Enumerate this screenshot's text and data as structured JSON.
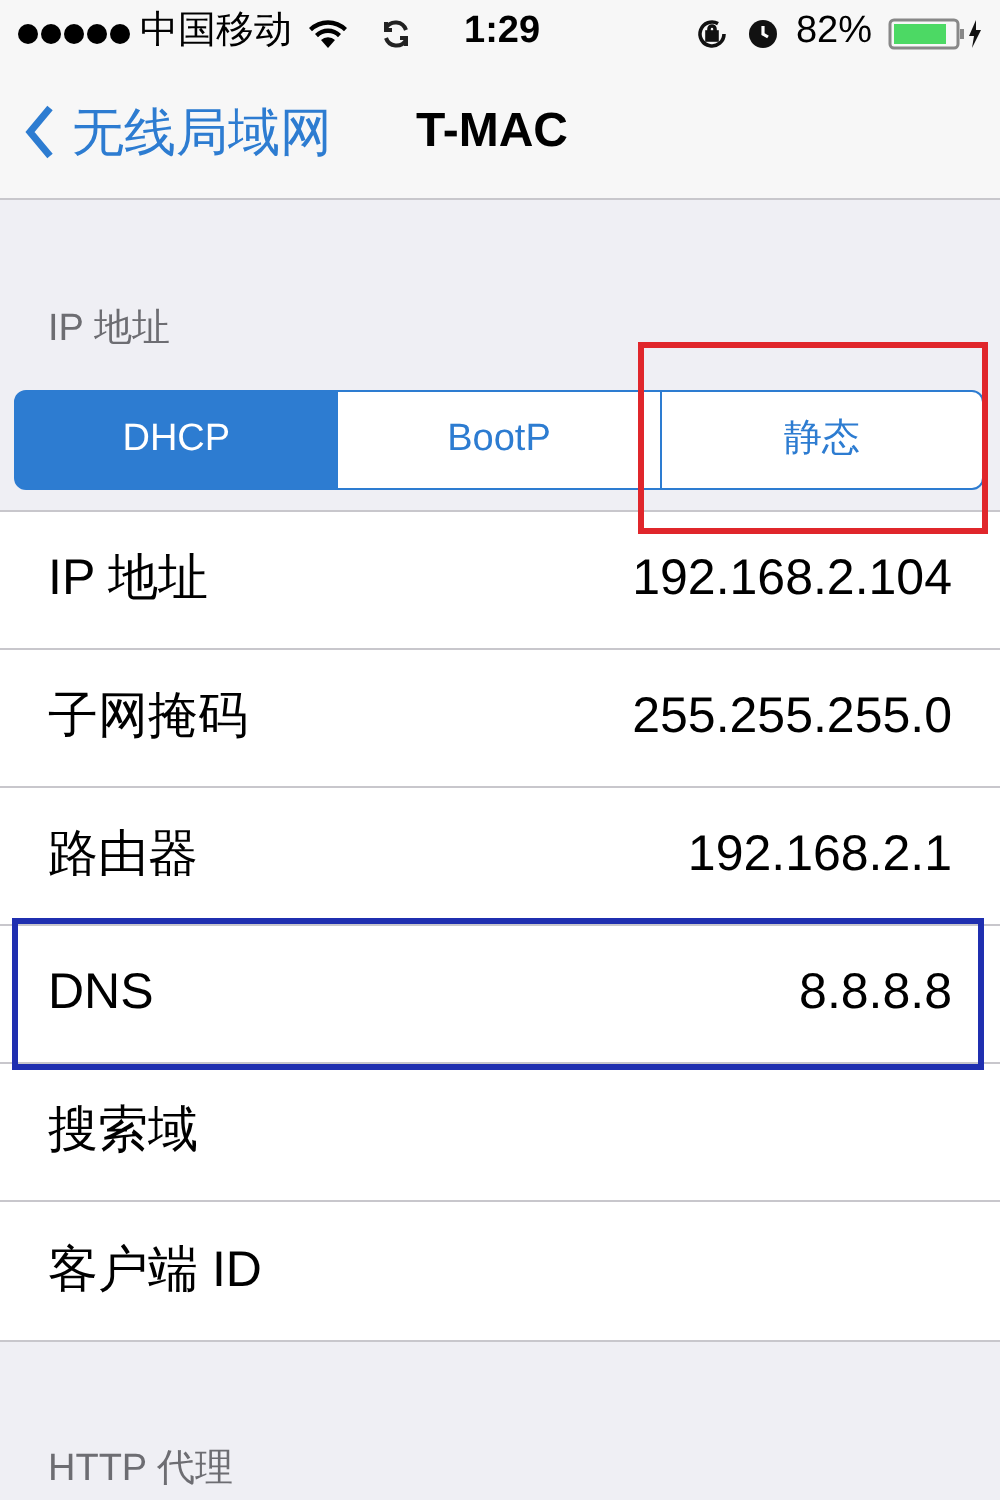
{
  "status_bar": {
    "carrier": "中国移动",
    "time": "1:29",
    "battery": "82%"
  },
  "nav": {
    "back": "无线局域网",
    "title": "T-MAC"
  },
  "section": {
    "header": "IP 地址"
  },
  "segments": [
    {
      "label": "DHCP",
      "selected": true
    },
    {
      "label": "BootP",
      "selected": false
    },
    {
      "label": "静态",
      "selected": false,
      "color": "#e0262b"
    }
  ],
  "rows": [
    {
      "label": "IP 地址",
      "value": "192.168.2.104"
    },
    {
      "label": "子网掩码",
      "value": "255.255.255.0"
    },
    {
      "label": "路由器",
      "value": "192.168.2.1"
    },
    {
      "label": "DNS",
      "value": "8.8.8.8",
      "color": "#1f2fb0"
    },
    {
      "label": "搜索域"
    },
    {
      "label": "客户端 ID"
    }
  ],
  "next_section": {
    "header": "HTTP 代理"
  }
}
